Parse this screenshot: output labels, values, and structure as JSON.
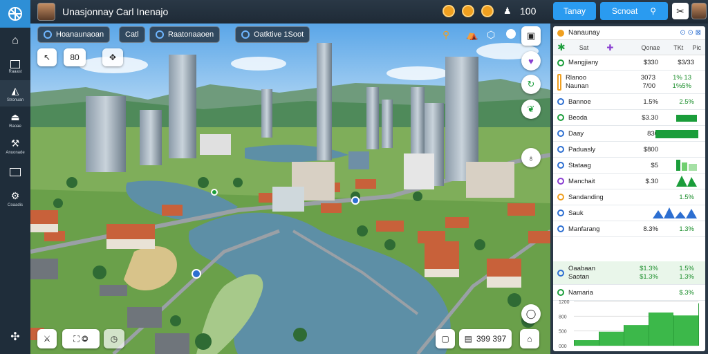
{
  "app": {
    "title": "Unasjonnay Carl Inenajo",
    "currency": "100"
  },
  "top_right": {
    "btn_today": "Tanay",
    "btn_search": "Scnoat"
  },
  "sidebar": {
    "items": [
      {
        "icon": "home-icon",
        "label": ""
      },
      {
        "icon": "building-icon",
        "label": "Raaast"
      },
      {
        "icon": "road-icon",
        "label": "Stronuan"
      },
      {
        "icon": "zone-icon",
        "label": "Raoae"
      },
      {
        "icon": "tools-icon",
        "label": "Anuonade"
      },
      {
        "icon": "terminal-icon",
        "label": ""
      },
      {
        "icon": "settings-icon",
        "label": "Coaadis"
      }
    ]
  },
  "map_bar": {
    "pill1": "Hoanaunaoan",
    "pill2": "Catl",
    "pill3": "Raatonaaoen",
    "pill4": "Oatktive 1Soot"
  },
  "map_tools": {
    "speed_label": "80"
  },
  "bottom_tools": {
    "counter": "399 397"
  },
  "panel": {
    "header": "Nanaunay",
    "cols": [
      "Sat",
      "Qonae",
      "TKt",
      "Pic"
    ],
    "summary": {
      "name": "Mangjiany",
      "v1": "$330",
      "v2": "$3/33"
    },
    "rows": [
      {
        "name": "Rlanoo",
        "sub": "Naunan",
        "v1": "3073",
        "v2": "1% 13",
        "v3": "7/00",
        "v4": "1%5%",
        "icon_color": "#f0a020"
      },
      {
        "name": "Bannoe",
        "v1": "1.5%",
        "v2": "2.5%",
        "icon_color": "#2d6fd1"
      },
      {
        "name": "Beoda",
        "v1": "$3.30",
        "v2": "5.3%",
        "icon_color": "#1a9d3a"
      },
      {
        "name": "Daay",
        "v1": "830",
        "v2": "3.3%",
        "icon_color": "#2d6fd1"
      },
      {
        "name": "Paduasly",
        "v1": "$800",
        "v2": "",
        "icon_color": "#2d6fd1"
      },
      {
        "name": "Stataag",
        "v1": "$5",
        "v2": "",
        "icon_color": "#2d6fd1"
      },
      {
        "name": "Manchait",
        "v1": "$.30",
        "v2": "",
        "icon_color": "#8a3fd1"
      },
      {
        "name": "Sandanding",
        "v1": "",
        "v2": "1.5%",
        "icon_color": "#f0a020"
      },
      {
        "name": "Sauk",
        "v1": "",
        "v2": "",
        "icon_color": "#2d6fd1"
      },
      {
        "name": "Manfarang",
        "v1": "8.3%",
        "v2": "1.3%",
        "icon_color": "#2d6fd1"
      },
      {
        "name": "Oaabaan",
        "sub": "Saotan",
        "v1": "$1.3%",
        "v2": "1.5%",
        "v3": "$1.3%",
        "v4": "1.3%",
        "icon_color": "#2d6fd1"
      },
      {
        "name": "Namaria",
        "v1": "",
        "v2": "$.3%",
        "icon_color": "#1a9d3a"
      }
    ],
    "chart_ticks": [
      "1200",
      "800",
      "500",
      "000"
    ]
  },
  "chart_data": {
    "type": "area",
    "x": [
      0,
      1,
      2,
      3,
      4,
      5
    ],
    "series": [
      {
        "values": [
          150,
          380,
          560,
          900,
          820,
          1150
        ]
      }
    ],
    "ylim": [
      0,
      1200
    ],
    "yticks": [
      "1200",
      "800",
      "500",
      "000"
    ]
  }
}
